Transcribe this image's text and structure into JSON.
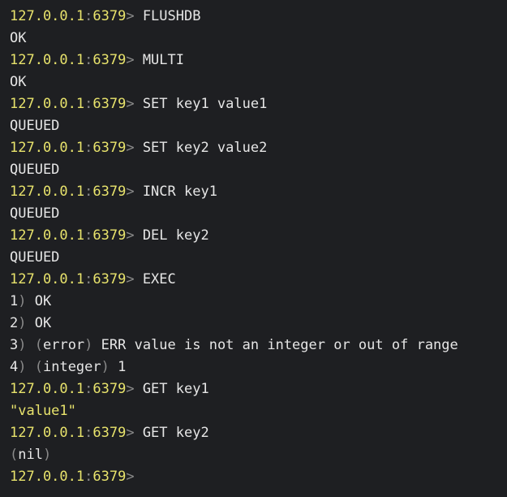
{
  "prompt": {
    "host": "127.0.0.1",
    "sep": ":",
    "port": "6379",
    "gt": ">"
  },
  "lines": [
    {
      "kind": "cmd",
      "text": "FLUSHDB"
    },
    {
      "kind": "out",
      "text": "OK"
    },
    {
      "kind": "cmd",
      "text": "MULTI"
    },
    {
      "kind": "out",
      "text": "OK"
    },
    {
      "kind": "cmd",
      "text": "SET key1 value1"
    },
    {
      "kind": "out",
      "text": "QUEUED"
    },
    {
      "kind": "cmd",
      "text": "SET key2 value2"
    },
    {
      "kind": "out",
      "text": "QUEUED"
    },
    {
      "kind": "cmd",
      "text": "INCR key1"
    },
    {
      "kind": "out",
      "text": "QUEUED"
    },
    {
      "kind": "cmd",
      "text": "DEL key2"
    },
    {
      "kind": "out",
      "text": "QUEUED"
    },
    {
      "kind": "cmd",
      "text": "EXEC"
    },
    {
      "kind": "res",
      "n": "1",
      "tag": "",
      "text": "OK"
    },
    {
      "kind": "res",
      "n": "2",
      "tag": "",
      "text": "OK"
    },
    {
      "kind": "res",
      "n": "3",
      "tag": "error",
      "text": "ERR value is not an integer or out of range"
    },
    {
      "kind": "res",
      "n": "4",
      "tag": "integer",
      "text": "1"
    },
    {
      "kind": "cmd",
      "text": "GET key1"
    },
    {
      "kind": "str",
      "text": "\"value1\""
    },
    {
      "kind": "cmd",
      "text": "GET key2"
    },
    {
      "kind": "nil",
      "text": "nil"
    },
    {
      "kind": "cmd",
      "text": ""
    }
  ]
}
